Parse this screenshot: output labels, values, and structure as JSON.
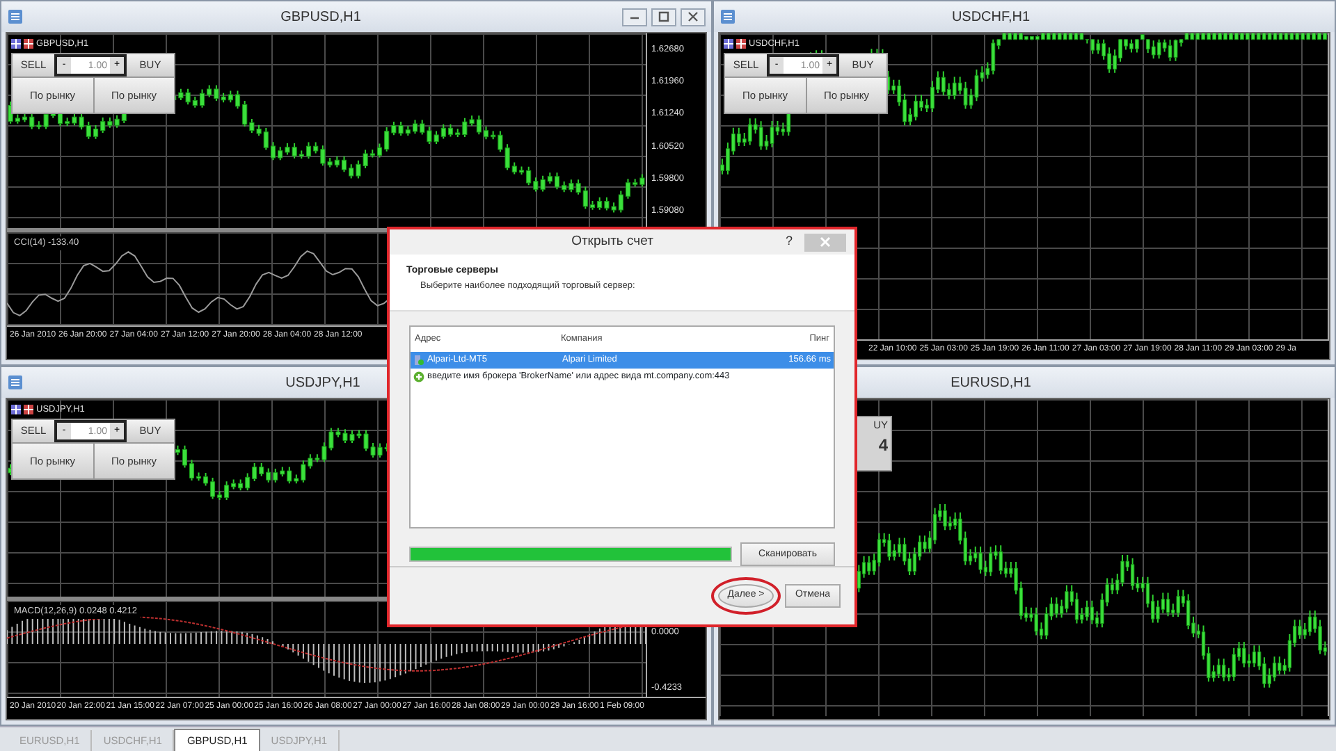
{
  "windows": [
    {
      "title": "GBPUSD,H1",
      "symbol_label": "GBPUSD,H1",
      "controls": true,
      "trade_panel": {
        "sell": "SELL",
        "minus": "-",
        "lot": "1.00",
        "plus": "+",
        "buy": "BUY",
        "sell_market": "По рынку",
        "buy_market": "По рынку"
      },
      "price_labels": [
        "1.62680",
        "1.61960",
        "1.61240",
        "1.60520",
        "1.59800",
        "1.59080"
      ],
      "indicator": {
        "kind": "cci",
        "label": "CCI(14) -133.40"
      },
      "time_labels": [
        "26 Jan 2010",
        "26 Jan 20:00",
        "27 Jan 04:00",
        "27 Jan 12:00",
        "27 Jan 20:00",
        "28 Jan 04:00",
        "28 Jan 12:00"
      ]
    },
    {
      "title": "USDCHF,H1",
      "symbol_label": "USDCHF,H1",
      "controls": false,
      "trade_panel": {
        "sell": "SELL",
        "minus": "-",
        "lot": "1.00",
        "plus": "+",
        "buy": "BUY",
        "sell_market": "По рынку",
        "buy_market": "По рынку"
      },
      "time_labels": [
        "22 Jan 10:00",
        "25 Jan 03:00",
        "25 Jan 19:00",
        "26 Jan 11:00",
        "27 Jan 03:00",
        "27 Jan 19:00",
        "28 Jan 11:00",
        "29 Jan 03:00",
        "29 Ja"
      ]
    },
    {
      "title": "USDJPY,H1",
      "symbol_label": "USDJPY,H1",
      "controls": false,
      "trade_panel": {
        "sell": "SELL",
        "minus": "-",
        "lot": "1.00",
        "plus": "+",
        "buy": "BUY",
        "sell_market": "По рынку",
        "buy_market": "По рынку"
      },
      "indicator": {
        "kind": "macd",
        "label": "MACD(12,26,9) 0.0248 0.4212",
        "scale_labels": [
          "0.0000",
          "-0.4233"
        ]
      },
      "time_labels": [
        "20 Jan 2010",
        "20 Jan 22:00",
        "21 Jan 15:00",
        "22 Jan 07:00",
        "25 Jan 00:00",
        "25 Jan 16:00",
        "26 Jan 08:00",
        "27 Jan 00:00",
        "27 Jan 16:00",
        "28 Jan 08:00",
        "29 Jan 00:00",
        "29 Jan 16:00",
        "1 Feb 09:00"
      ]
    },
    {
      "title": "EURUSD,H1",
      "controls": false,
      "trade_panel_fragment": {
        "buy": "UY",
        "price": "4"
      }
    }
  ],
  "tabs": [
    {
      "label": "EURUSD,H1",
      "selected": false
    },
    {
      "label": "USDCHF,H1",
      "selected": false
    },
    {
      "label": "GBPUSD,H1",
      "selected": true
    },
    {
      "label": "USDJPY,H1",
      "selected": false
    }
  ],
  "dialog": {
    "title": "Открыть счет",
    "help": "?",
    "heading": "Торговые серверы",
    "subheading": "Выберите наиболее подходящий торговый сервер:",
    "columns": [
      "Адрес",
      "Компания",
      "Пинг"
    ],
    "rows": [
      {
        "kind": "server",
        "address": "Alpari-Ltd-MT5",
        "company": "Alpari Limited",
        "ping": "156.66 ms",
        "selected": true
      },
      {
        "kind": "hint",
        "text": "введите имя брокера 'BrokerName' или адрес вида mt.company.com:443",
        "selected": false
      }
    ],
    "scan_progress": {
      "level": 1.0
    },
    "scan_button": "Сканировать",
    "buttons": [
      {
        "label": "Далее >",
        "circled": true
      },
      {
        "label": "Отмена",
        "circled": false
      }
    ]
  }
}
